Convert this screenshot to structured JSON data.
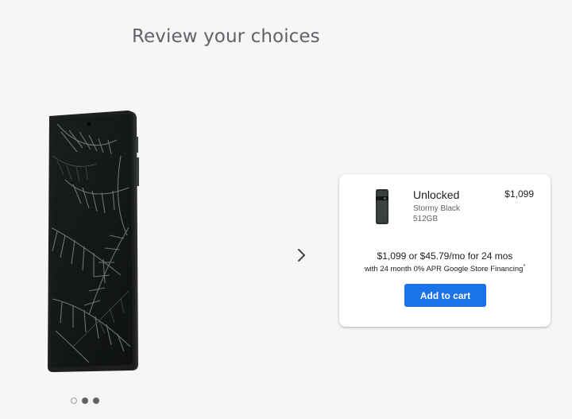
{
  "page": {
    "title": "Review your choices"
  },
  "icons": {
    "next": "chevron-right-icon",
    "phone": "phone-illustration"
  },
  "carousel": {
    "dots": [
      {
        "state": "empty"
      },
      {
        "state": "filled"
      },
      {
        "state": "filled"
      }
    ]
  },
  "summary": {
    "product_name": "Unlocked",
    "price": "$1,099",
    "color": "Stormy Black",
    "storage": "512GB",
    "price_line": "$1,099 or $45.79/mo for 24 mos",
    "financing_line": "with 24 month 0% APR Google Store Financing",
    "financing_footnote": "*",
    "add_to_cart_label": "Add to cart"
  },
  "colors": {
    "accent": "#1a73e8",
    "background": "#f6f6f6",
    "card": "#ffffff",
    "phone_body": "#1c1f1d"
  }
}
